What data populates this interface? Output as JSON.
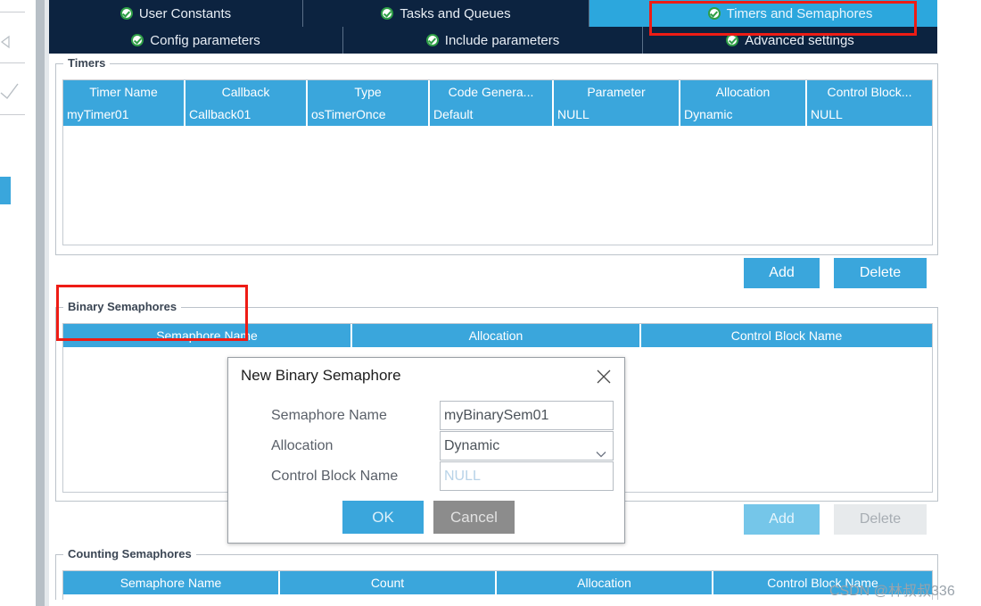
{
  "window": {
    "accent_blue": "#3aa6dc",
    "tab_navy": "#0c2340",
    "annotation_red": "#ee1c15"
  },
  "tabs": {
    "row1": [
      {
        "label": "User Constants",
        "icon": "green-check-icon",
        "active": false
      },
      {
        "label": "Tasks and Queues",
        "icon": "green-check-icon",
        "active": false
      },
      {
        "label": "Timers and Semaphores",
        "icon": "green-check-icon",
        "active": true
      }
    ],
    "row2": [
      {
        "label": "Config parameters",
        "icon": "green-check-icon",
        "active": false
      },
      {
        "label": "Include parameters",
        "icon": "green-check-icon",
        "active": false
      },
      {
        "label": "Advanced settings",
        "icon": "green-check-icon",
        "active": false
      }
    ]
  },
  "timers": {
    "legend": "Timers",
    "columns": [
      "Timer Name",
      "Callback",
      "Type",
      "Code Genera...",
      "Parameter",
      "Allocation",
      "Control Block..."
    ],
    "rows": [
      [
        "myTimer01",
        "Callback01",
        "osTimerOnce",
        "Default",
        "NULL",
        "Dynamic",
        "NULL"
      ]
    ],
    "add_label": "Add",
    "delete_label": "Delete"
  },
  "binary_semaphores": {
    "legend": "Binary Semaphores",
    "columns": [
      "Semaphore Name",
      "Allocation",
      "Control Block Name"
    ],
    "rows": [],
    "add_label": "Add",
    "delete_label": "Delete"
  },
  "counting_semaphores": {
    "legend": "Counting Semaphores",
    "columns": [
      "Semaphore Name",
      "Count",
      "Allocation",
      "Control Block Name"
    ],
    "rows": []
  },
  "dialog": {
    "title": "New Binary Semaphore",
    "close_icon": "close-icon",
    "fields": [
      {
        "label": "Semaphore Name",
        "value": "myBinarySem01",
        "type": "text",
        "placeholder": ""
      },
      {
        "label": "Allocation",
        "value": "Dynamic",
        "type": "select",
        "placeholder": ""
      },
      {
        "label": "Control Block Name",
        "value": "",
        "type": "text",
        "placeholder": "NULL"
      }
    ],
    "ok_label": "OK",
    "cancel_label": "Cancel"
  },
  "watermark": {
    "text": "CSDN @林叔叔336"
  }
}
